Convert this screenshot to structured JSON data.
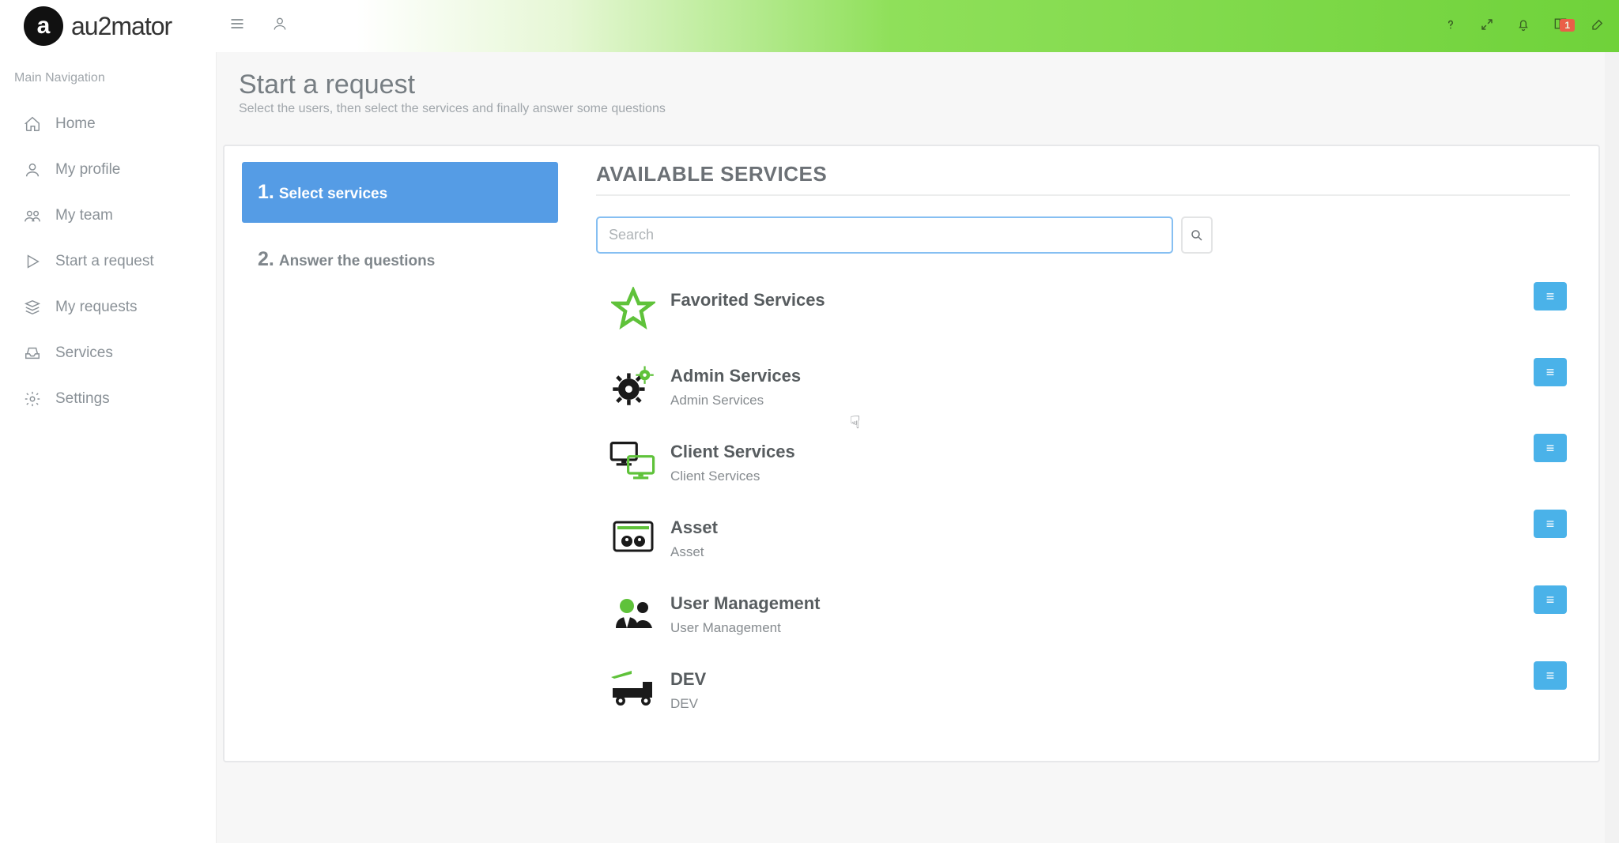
{
  "brand": {
    "name": "au2mator",
    "badge": "a"
  },
  "header": {
    "notifications_badge": "1"
  },
  "sidebar": {
    "heading": "Main Navigation",
    "items": [
      {
        "label": "Home"
      },
      {
        "label": "My profile"
      },
      {
        "label": "My team"
      },
      {
        "label": "Start a request"
      },
      {
        "label": "My requests"
      },
      {
        "label": "Services"
      },
      {
        "label": "Settings"
      }
    ]
  },
  "page": {
    "title": "Start a request",
    "subtitle": "Select the users, then select the services and finally answer some questions"
  },
  "wizard": {
    "steps": [
      {
        "n": "1.",
        "label": "Select services"
      },
      {
        "n": "2.",
        "label": "Answer the questions"
      }
    ]
  },
  "services": {
    "heading": "AVAILABLE SERVICES",
    "search_placeholder": "Search",
    "items": [
      {
        "title": "Favorited Services",
        "desc": ""
      },
      {
        "title": "Admin Services",
        "desc": "Admin Services"
      },
      {
        "title": "Client Services",
        "desc": "Client Services"
      },
      {
        "title": "Asset",
        "desc": "Asset"
      },
      {
        "title": "User Management",
        "desc": "User Management"
      },
      {
        "title": "DEV",
        "desc": "DEV"
      }
    ],
    "action_glyph": "≡"
  }
}
